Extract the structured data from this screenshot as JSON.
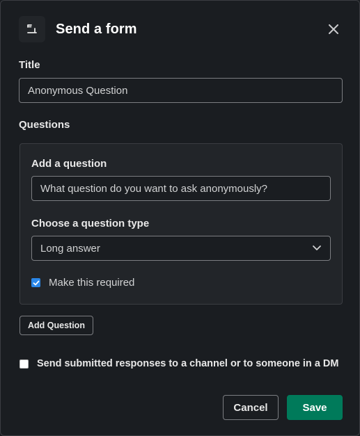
{
  "header": {
    "title": "Send a form",
    "app_icon": "form-icon",
    "close_icon": "close-icon"
  },
  "form": {
    "title_label": "Title",
    "title_value": "Anonymous Question",
    "questions_label": "Questions",
    "question": {
      "add_label": "Add a question",
      "question_value": "What question do you want to ask anonymously?",
      "type_label": "Choose a question type",
      "type_value": "Long answer",
      "required_label": "Make this required",
      "required_checked": true
    },
    "add_question_button": "Add Question",
    "send_responses_label": "Send submitted responses to a channel or to someone in a DM",
    "send_responses_checked": false
  },
  "footer": {
    "cancel_label": "Cancel",
    "save_label": "Save"
  },
  "colors": {
    "background": "#1a1d21",
    "panel": "#222529",
    "primary": "#007a5a",
    "checkbox_accent": "#2a87e8"
  }
}
